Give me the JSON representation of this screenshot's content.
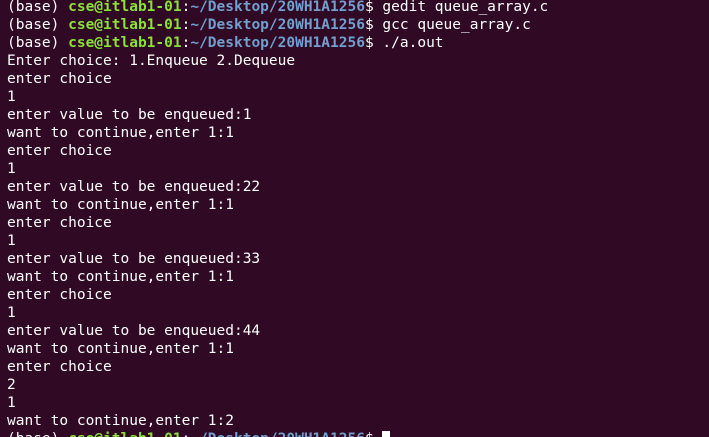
{
  "terminal": {
    "prompt": {
      "env": "(base) ",
      "userhost": "cse@itlab1-01",
      "colon": ":",
      "path": "~/Desktop/20WH1A1256",
      "symbol": "$ "
    },
    "commands": [
      "gedit queue_array.c",
      "gcc queue_array.c",
      "./a.out"
    ],
    "output": [
      "Enter choice: 1.Enqueue 2.Dequeue",
      "enter choice",
      "1",
      "enter value to be enqueued:1",
      "want to continue,enter 1:1",
      "enter choice",
      "1",
      "enter value to be enqueued:22",
      "want to continue,enter 1:1",
      "enter choice",
      "1",
      "enter value to be enqueued:33",
      "want to continue,enter 1:1",
      "enter choice",
      "1",
      "enter value to be enqueued:44",
      "want to continue,enter 1:1",
      "enter choice",
      "2",
      "1",
      "want to continue,enter 1:2"
    ],
    "colors": {
      "background": "#300a24",
      "text": "#ffffff",
      "userhost": "#8ae234",
      "path": "#729fcf"
    }
  }
}
